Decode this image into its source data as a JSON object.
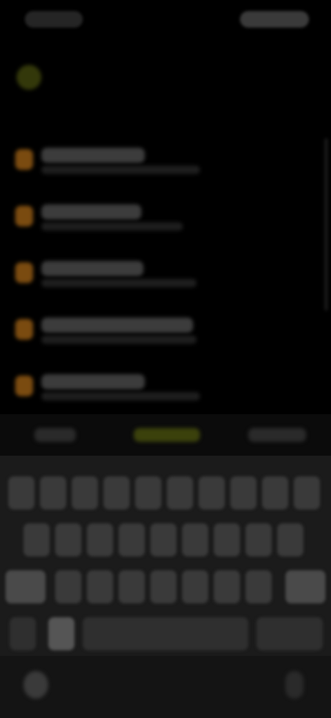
{
  "header": {
    "title": ""
  },
  "list": {
    "items": [
      {
        "title": "",
        "subtitle": ""
      },
      {
        "title": "",
        "subtitle": ""
      },
      {
        "title": "",
        "subtitle": ""
      },
      {
        "title": "",
        "subtitle": ""
      },
      {
        "title": "",
        "subtitle": ""
      }
    ]
  },
  "keyboard": {
    "suggestions": [
      "",
      "",
      ""
    ]
  },
  "colors": {
    "background": "#000000",
    "accent": "#7a4b10",
    "highlight": "#3b410c",
    "keyboard_bg": "#1b1b1b"
  }
}
